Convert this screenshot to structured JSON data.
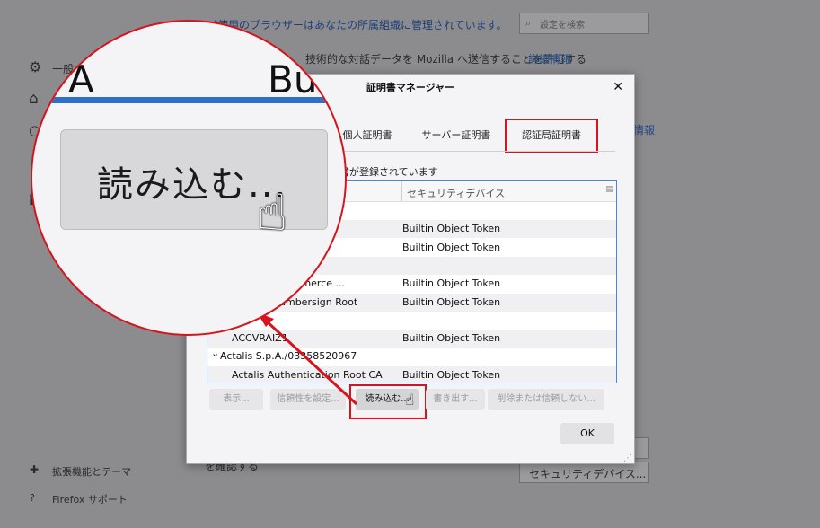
{
  "background": {
    "managed_notice": "ご使用のブラウザーはあなたの所属組織に管理されています。",
    "search_placeholder": "設定を検索",
    "sidebar_general": "一般",
    "telemetry_text": "技術的な対話データを Mozilla へ送信することを許可する",
    "details_link": "詳細情報",
    "info_link": "情報",
    "extensions": "拡張機能とテーマ",
    "support": "Firefox サポート",
    "confirm_text": "を確認する",
    "security_devices_button": "セキュリティデバイス..."
  },
  "dialog": {
    "title": "証明書マネージャー",
    "tabs": [
      "個人証明書",
      "サーバー証明書",
      "認証局証明書"
    ],
    "active_tab": "認証局証明書",
    "info_text": "書が登録されています",
    "column_device": "セキュリティデバイス",
    "rows": [
      {
        "name": "",
        "device": "",
        "alt": false
      },
      {
        "name": "Root - 2008",
        "device": "Builtin Object Token",
        "alt": true
      },
      {
        "name": "ot - 2008",
        "device": "Builtin Object Token",
        "alt": false
      },
      {
        "name": "A82743287",
        "device": "",
        "alt": true
      },
      {
        "name": "mbers of Commerce ...",
        "device": "Builtin Object Token",
        "alt": false
      },
      {
        "name": "Global Chambersign Root",
        "device": "Builtin Object Token",
        "alt": true
      },
      {
        "name": "",
        "device": "",
        "alt": false
      },
      {
        "name": "ACCVRAIZ1",
        "device": "Builtin Object Token",
        "alt": true
      },
      {
        "name": "Actalis S.p.A./03358520967",
        "device": "",
        "alt": false,
        "group": true
      },
      {
        "name": "Actalis Authentication Root CA",
        "device": "Builtin Object Token",
        "alt": true
      }
    ],
    "buttons": {
      "view": "表示...",
      "trust": "信頼性を設定...",
      "import": "読み込む...",
      "export": "書き出す...",
      "delete": "削除または信頼しない...",
      "ok": "OK"
    }
  },
  "magnifier": {
    "label": "読み込む...",
    "fragment_left": "A",
    "fragment_right": "Bu"
  },
  "colors": {
    "highlight_red": "#d7131d",
    "accent_blue": "#2f6fc4"
  }
}
